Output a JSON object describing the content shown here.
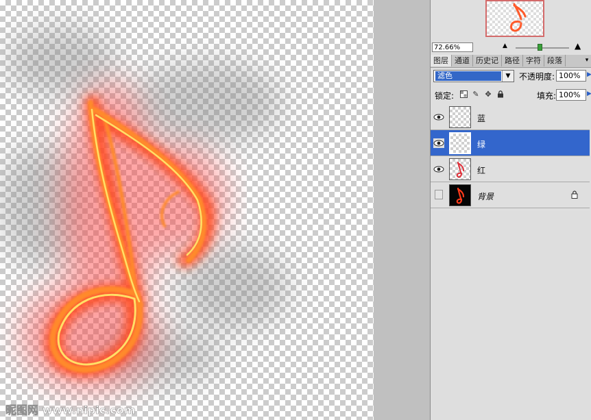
{
  "canvas": {
    "watermark": "昵图网 www.nipic.com"
  },
  "navigator": {
    "zoom": "72.66%",
    "zoom_out_icon": "small-mountain-icon",
    "zoom_in_icon": "large-mountain-icon"
  },
  "tabs": [
    {
      "label": "图层"
    },
    {
      "label": "通道"
    },
    {
      "label": "历史记"
    },
    {
      "label": "路径"
    },
    {
      "label": "字符"
    },
    {
      "label": "段落"
    }
  ],
  "layers_panel": {
    "blend_mode": "滤色",
    "opacity_label": "不透明度:",
    "opacity": "100%",
    "lock_label": "锁定:",
    "fill_label": "填充:",
    "fill": "100%"
  },
  "layers": [
    {
      "name": "蓝",
      "visible": true,
      "selected": false
    },
    {
      "name": "绿",
      "visible": true,
      "selected": true
    },
    {
      "name": "红",
      "visible": true,
      "selected": false
    },
    {
      "name": "背景",
      "visible": false,
      "selected": false,
      "locked": true
    }
  ],
  "colors": {
    "selection": "#3366cc",
    "flame": "#ff6a1a",
    "flame_core": "#ffe066"
  }
}
